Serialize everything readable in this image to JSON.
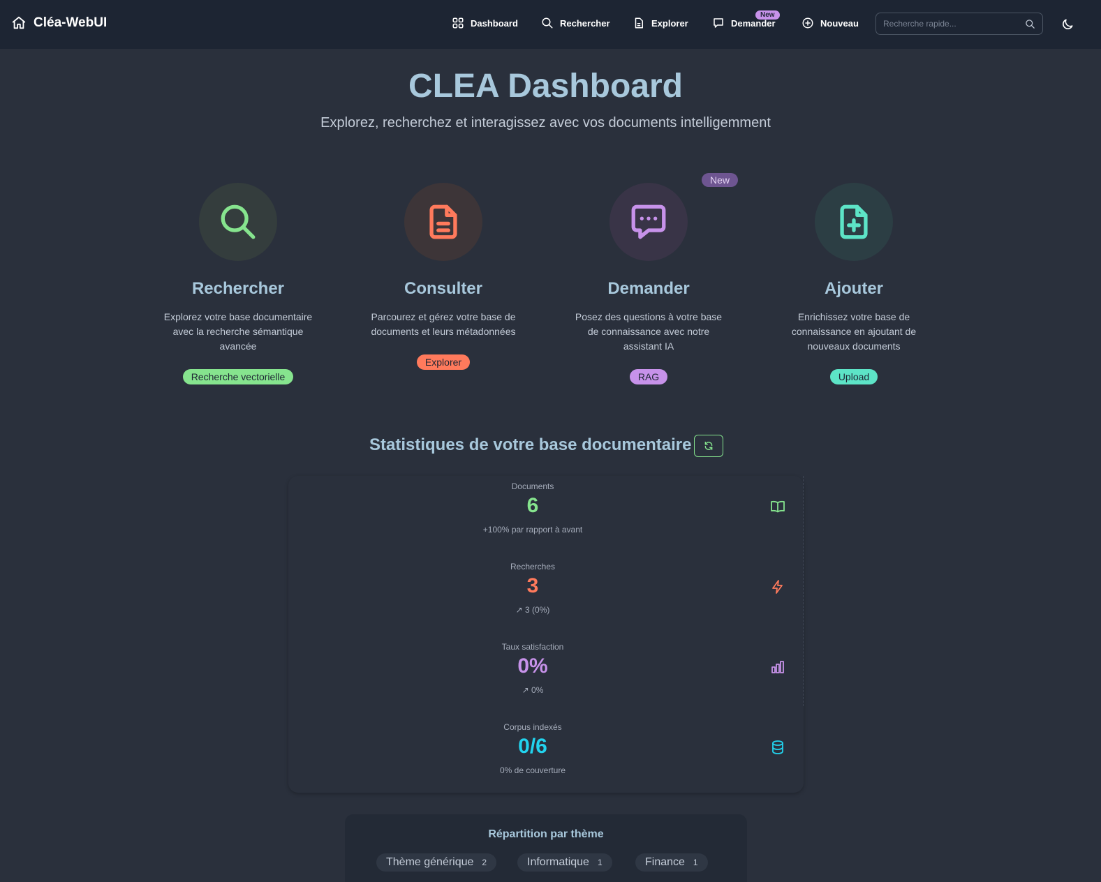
{
  "brand": {
    "name": "Cléa-WebUI"
  },
  "nav": {
    "items": [
      {
        "label": "Dashboard"
      },
      {
        "label": "Rechercher"
      },
      {
        "label": "Explorer"
      },
      {
        "label": "Demander",
        "badge": "New"
      },
      {
        "label": "Nouveau"
      }
    ],
    "search_placeholder": "Recherche rapide..."
  },
  "hero": {
    "title": "CLEA Dashboard",
    "subtitle": "Explorez, recherchez et interagissez avec vos documents intelligemment"
  },
  "features": [
    {
      "title": "Rechercher",
      "description": "Explorez votre base documentaire avec la recherche sémantique avancée",
      "badge": "Recherche vectorielle",
      "color": "#86e48e"
    },
    {
      "title": "Consulter",
      "description": "Parcourez et gérez votre base de documents et leurs métadonnées",
      "badge": "Explorer",
      "color": "#ff7a5c"
    },
    {
      "title": "Demander",
      "description": "Posez des questions à votre base de connaissance avec notre assistant IA",
      "badge": "RAG",
      "color": "#c792ea",
      "new_label": "New"
    },
    {
      "title": "Ajouter",
      "description": "Enrichissez votre base de connaissance en ajoutant de nouveaux documents",
      "badge": "Upload",
      "color": "#5de4c7"
    }
  ],
  "stats": {
    "title": "Statistiques de votre base documentaire",
    "items": [
      {
        "label": "Documents",
        "value": "6",
        "desc": "+100% par rapport à avant",
        "color": "#86e48e",
        "icon": "book-icon"
      },
      {
        "label": "Recherches",
        "value": "3",
        "desc": "↗ 3 (0%)",
        "color": "#ff7a5c",
        "icon": "bolt-icon"
      },
      {
        "label": "Taux satisfaction",
        "value": "0%",
        "desc": "↗ 0%",
        "color": "#c792ea",
        "icon": "bar-chart-icon"
      },
      {
        "label": "Corpus indexés",
        "value": "0/6",
        "desc": "0% de couverture",
        "color": "#22d3ee",
        "icon": "database-icon"
      }
    ]
  },
  "themes": {
    "title": "Répartition par thème",
    "items": [
      {
        "name": "Thème générique",
        "count": "2"
      },
      {
        "name": "Informatique",
        "count": "1"
      },
      {
        "name": "Finance",
        "count": "1"
      }
    ]
  }
}
